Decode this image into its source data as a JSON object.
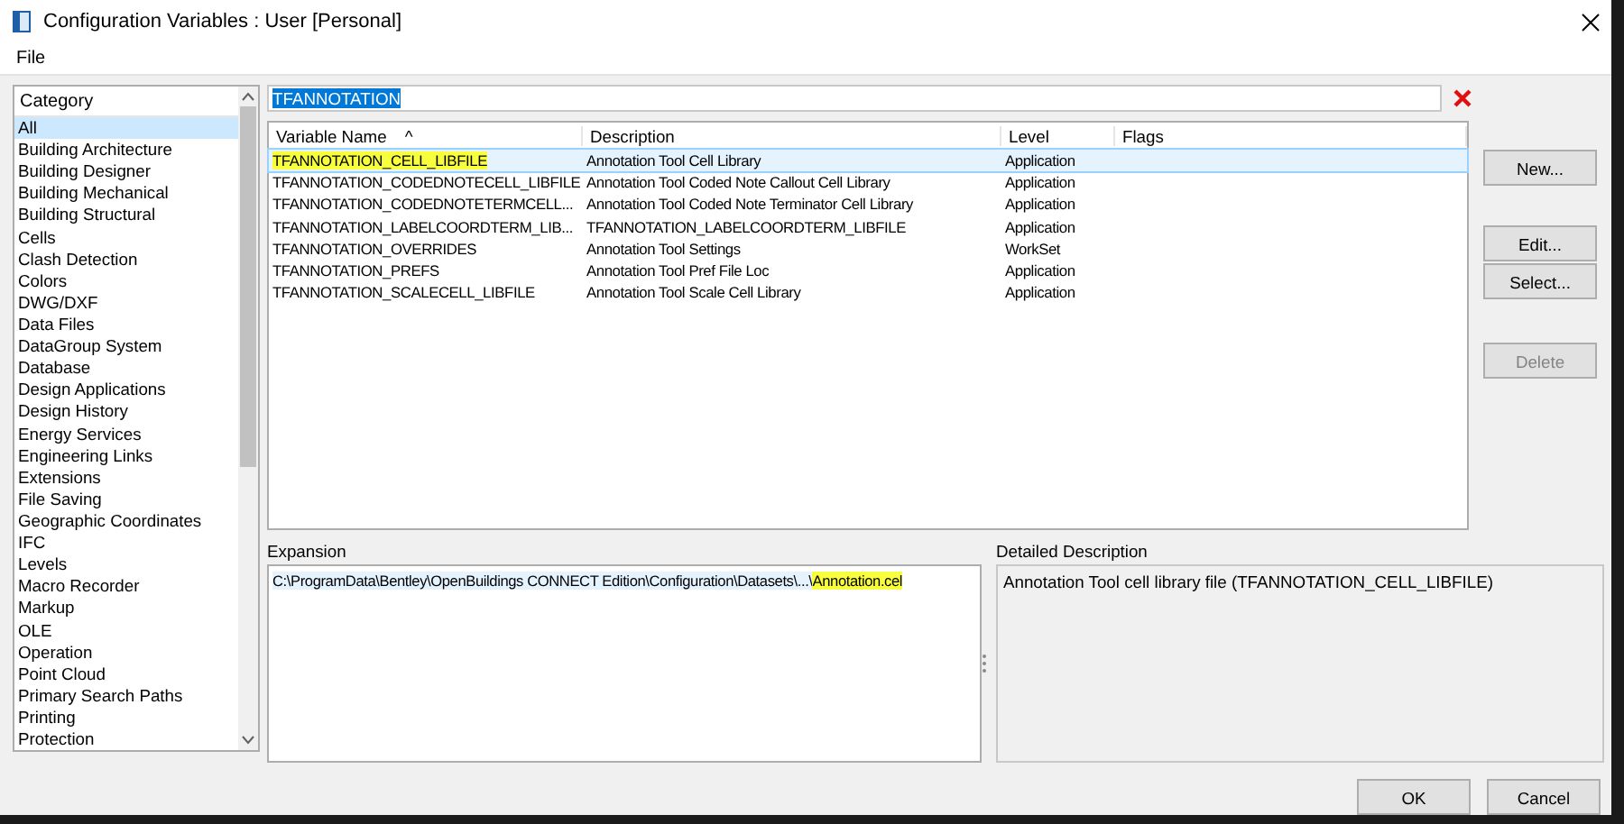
{
  "window": {
    "title": "Configuration Variables : User [Personal]"
  },
  "menu": [
    "File"
  ],
  "category_list": {
    "heading": "Category",
    "items": [
      {
        "label": "All",
        "selected": true
      },
      {
        "label": "Building Architecture",
        "selected": false
      },
      {
        "label": "Building Designer",
        "selected": false
      },
      {
        "label": "Building Mechanical",
        "selected": false
      },
      {
        "label": "Building Structural",
        "selected": false
      },
      {
        "label": "Cells",
        "selected": false
      },
      {
        "label": "Clash Detection",
        "selected": false
      },
      {
        "label": "Colors",
        "selected": false
      },
      {
        "label": "DWG/DXF",
        "selected": false
      },
      {
        "label": "Data Files",
        "selected": false
      },
      {
        "label": "DataGroup System",
        "selected": false
      },
      {
        "label": "Database",
        "selected": false
      },
      {
        "label": "Design Applications",
        "selected": false
      },
      {
        "label": "Design History",
        "selected": false
      },
      {
        "label": "Energy Services",
        "selected": false
      },
      {
        "label": "Engineering Links",
        "selected": false
      },
      {
        "label": "Extensions",
        "selected": false
      },
      {
        "label": "File Saving",
        "selected": false
      },
      {
        "label": "Geographic Coordinates",
        "selected": false
      },
      {
        "label": "IFC",
        "selected": false
      },
      {
        "label": "Levels",
        "selected": false
      },
      {
        "label": "Macro Recorder",
        "selected": false
      },
      {
        "label": "Markup",
        "selected": false
      },
      {
        "label": "OLE",
        "selected": false
      },
      {
        "label": "Operation",
        "selected": false
      },
      {
        "label": "Point Cloud",
        "selected": false
      },
      {
        "label": "Primary Search Paths",
        "selected": false
      },
      {
        "label": "Printing",
        "selected": false
      },
      {
        "label": "Protection",
        "selected": false
      }
    ]
  },
  "search": {
    "value": "TFANNOTATION"
  },
  "table": {
    "columns": [
      "Variable Name",
      "Description",
      "Level",
      "Flags"
    ],
    "sort_indicator": "^",
    "rows": [
      {
        "name": "TFANNOTATION_CELL_LIBFILE",
        "description": "Annotation Tool Cell Library",
        "level": "Application",
        "selected": true,
        "highlighted": true
      },
      {
        "name": "TFANNOTATION_CODEDNOTECELL_LIBFILE",
        "description": "Annotation Tool Coded Note Callout Cell Library",
        "level": "Application",
        "selected": false,
        "highlighted": false
      },
      {
        "name": "TFANNOTATION_CODEDNOTETERMCELL...",
        "description": "Annotation Tool Coded Note Terminator Cell Library",
        "level": "Application",
        "selected": false,
        "highlighted": false
      },
      {
        "name": "TFANNOTATION_LABELCOORDTERM_LIB...",
        "description": "TFANNOTATION_LABELCOORDTERM_LIBFILE",
        "level": "Application",
        "selected": false,
        "highlighted": false
      },
      {
        "name": "TFANNOTATION_OVERRIDES",
        "description": "Annotation Tool Settings",
        "level": "WorkSet",
        "selected": false,
        "highlighted": false
      },
      {
        "name": "TFANNOTATION_PREFS",
        "description": "Annotation Tool Pref File Loc",
        "level": "Application",
        "selected": false,
        "highlighted": false
      },
      {
        "name": "TFANNOTATION_SCALECELL_LIBFILE",
        "description": "Annotation Tool Scale Cell Library",
        "level": "Application",
        "selected": false,
        "highlighted": false
      }
    ]
  },
  "side_buttons": [
    {
      "label": "New...",
      "disabled": false
    },
    {
      "label": "Edit...",
      "disabled": false
    },
    {
      "label": "Select...",
      "disabled": false
    },
    {
      "label": "Delete",
      "disabled": true
    }
  ],
  "expansion": {
    "label": "Expansion",
    "path": "C:\\ProgramData\\Bentley\\OpenBuildings CONNECT Edition\\Configuration\\Datasets\\...\\",
    "highlight": "Annotation.cel"
  },
  "detailed_description": {
    "label": "Detailed Description",
    "text": "Annotation Tool cell library file (TFANNOTATION_CELL_LIBFILE)"
  },
  "footer_buttons": [
    "OK",
    "Cancel"
  ]
}
